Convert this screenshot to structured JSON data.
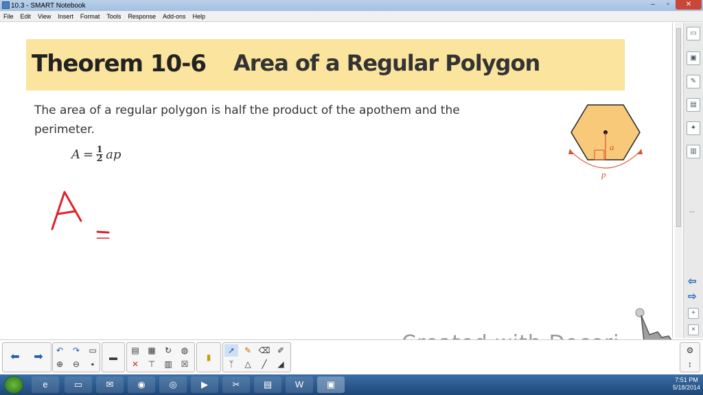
{
  "window": {
    "title": "10.3 - SMART Notebook",
    "min": "–",
    "restore": "▫",
    "close": "✕"
  },
  "menu": [
    "File",
    "Edit",
    "View",
    "Insert",
    "Format",
    "Tools",
    "Response",
    "Add-ons",
    "Help"
  ],
  "page": {
    "theorem": "Theorem 10-6",
    "heading": "Area of a Regular Polygon",
    "description": "The area of a regular polygon is half the product of the apothem and the perimeter.",
    "formula_lhs": "A",
    "formula_eq": "=",
    "formula_num": "1",
    "formula_den": "2",
    "formula_rhs": "ap",
    "hex_apothem_label": "a",
    "hex_perimeter_label": "p",
    "ink_text": "A ="
  },
  "overlay": {
    "watermark": "Created with Doceri"
  },
  "clock": {
    "time": "7:51 PM",
    "date": "5/18/2014"
  },
  "colors": {
    "banner": "#fbe49e",
    "hexagon": "#f9c97a",
    "ink": "#e0202c",
    "label": "#d9532c"
  }
}
